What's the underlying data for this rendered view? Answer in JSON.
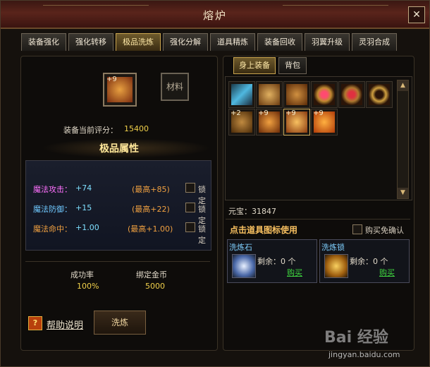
{
  "window": {
    "title": "熔炉",
    "close": "✕"
  },
  "tabs": [
    "装备强化",
    "强化转移",
    "极品洗炼",
    "强化分解",
    "道具精炼",
    "装备回收",
    "羽翼升级",
    "灵羽合成"
  ],
  "active_tab_index": 2,
  "left": {
    "equip_slot_badge": "+9",
    "material_slot_label": "材料",
    "score_label": "装备当前评分：",
    "score_value": "15400",
    "section_title": "极品属性",
    "attributes": [
      {
        "name": "魔法攻击：",
        "value": "+74",
        "max": "(最高+85)",
        "lock": "锁定",
        "name_color": "#ff70ff"
      },
      {
        "name": "魔法防御：",
        "value": "+15",
        "max": "(最高+22)",
        "lock": "锁定",
        "name_color": "#6fc8ff"
      },
      {
        "name": "魔法命中：",
        "value": "+1.00",
        "max": "(最高+1.00)",
        "lock": "锁定",
        "name_color": "#f0a040"
      }
    ],
    "success_label": "成功率",
    "success_value": "100%",
    "gold_label": "绑定金币",
    "gold_value": "5000",
    "help_icon": "?",
    "help_link": "帮助说明",
    "action_button": "洗炼"
  },
  "right": {
    "subtabs": [
      "身上装备",
      "背包"
    ],
    "active_subtab_index": 0,
    "items": [
      {
        "badge": "",
        "icon": "ice-sword-icon",
        "color": "#4fb8e0"
      },
      {
        "badge": "",
        "icon": "gold-gauntlet-icon",
        "color": "#c08a30"
      },
      {
        "badge": "",
        "icon": "gold-armor-icon",
        "color": "#b07020"
      },
      {
        "badge": "",
        "icon": "ruby-ring-icon",
        "color": "#d03a5a"
      },
      {
        "badge": "",
        "icon": "ruby-ring-icon",
        "color": "#c02a40"
      },
      {
        "badge": "",
        "icon": "gold-bracelet-icon",
        "color": "#d0a040"
      },
      {
        "badge": "+2",
        "icon": "bronze-boots-icon",
        "color": "#b07a30"
      },
      {
        "badge": "+9",
        "icon": "gold-helmet-icon",
        "color": "#d08030"
      },
      {
        "badge": "+9",
        "icon": "dragon-emblem-icon",
        "color": "#e0a040"
      },
      {
        "badge": "+9",
        "icon": "fire-orb-icon",
        "color": "#e06a20"
      }
    ],
    "yuanbao_label": "元宝：",
    "yuanbao_value": "31847",
    "tip": "点击道具图标使用",
    "no_confirm_label": "购买免确认",
    "stones": [
      {
        "name": "洗炼石",
        "icon": "refine-stone-icon",
        "left": "剩余：0 个",
        "buy": "购买"
      },
      {
        "name": "洗炼锁",
        "icon": "refine-lock-icon",
        "left": "剩余：0 个",
        "buy": "购买"
      }
    ]
  },
  "watermark": {
    "text": "Bai 经验",
    "sub": "jingyan.baidu.com"
  }
}
